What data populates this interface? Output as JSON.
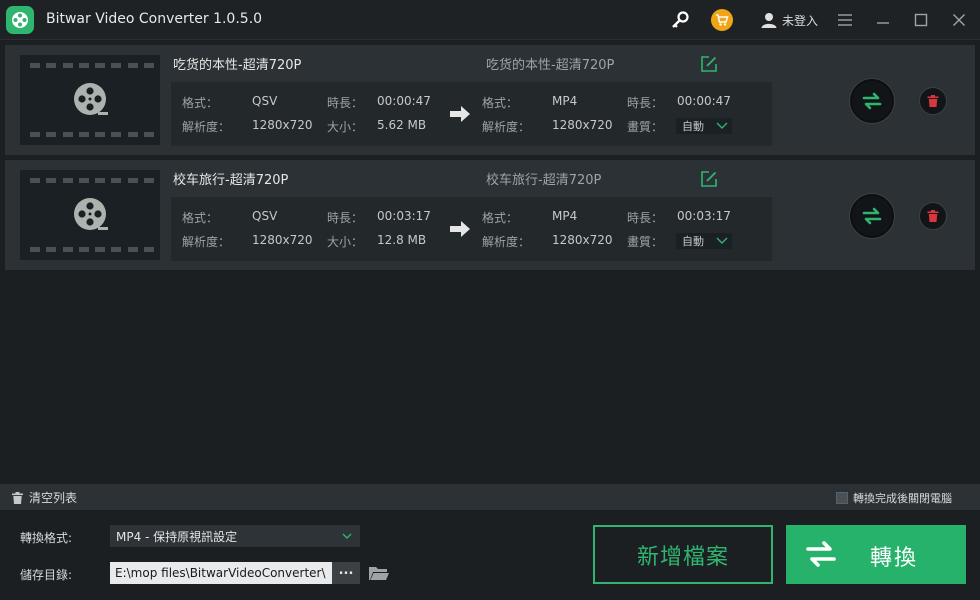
{
  "window": {
    "title": "Bitwar Video Converter  1.0.5.0",
    "user_label": "未登入"
  },
  "colors": {
    "accent": "#2fb570",
    "cart": "#f1a515",
    "delete": "#d9363e"
  },
  "labels": {
    "format": "格式：",
    "duration": "時長：",
    "resolution": "解析度：",
    "size": "大小：",
    "quality": "畫質："
  },
  "files": [
    {
      "name": "吃货的本性-超清720P",
      "output_name": "吃货的本性-超清720P",
      "source": {
        "format": "QSV",
        "duration": "00:00:47",
        "resolution": "1280x720",
        "size": "5.62 MB"
      },
      "target": {
        "format": "MP4",
        "duration": "00:00:47",
        "resolution": "1280x720",
        "quality": "自動"
      }
    },
    {
      "name": "校车旅行-超清720P",
      "output_name": "校车旅行-超清720P",
      "source": {
        "format": "QSV",
        "duration": "00:03:17",
        "resolution": "1280x720",
        "size": "12.8 MB"
      },
      "target": {
        "format": "MP4",
        "duration": "00:03:17",
        "resolution": "1280x720",
        "quality": "自動"
      }
    }
  ],
  "toolbar": {
    "clear_list": "清空列表",
    "shutdown_after": "轉換完成後關閉電腦",
    "shutdown_checked": false
  },
  "settings": {
    "format_label": "轉換格式:",
    "format_value": "MP4 - 保持原視訊設定",
    "save_label": "儲存目錄:",
    "save_path": "E:\\mop files\\BitwarVideoConverter\\",
    "browse_label": "..."
  },
  "actions": {
    "add_files": "新增檔案",
    "convert": "轉換"
  },
  "icons": {
    "logo": "film-reel-icon",
    "key": "key-icon",
    "cart": "cart-icon",
    "user": "user-icon",
    "menu": "menu-icon",
    "minimize": "minimize-icon",
    "maximize": "maximize-icon",
    "close": "close-icon",
    "edit": "edit-icon",
    "convert": "convert-arrows-icon",
    "delete": "trash-icon",
    "folder": "folder-icon"
  }
}
